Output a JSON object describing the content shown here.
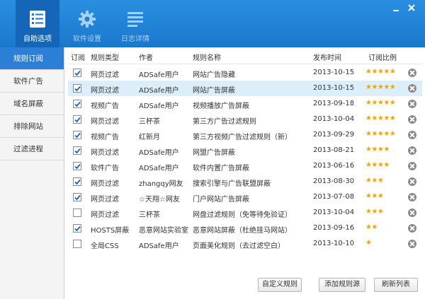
{
  "toolbar": {
    "items": [
      {
        "label": "自助选项",
        "icon": "checklist-icon"
      },
      {
        "label": "软件设置",
        "icon": "gear-icon"
      },
      {
        "label": "日志详情",
        "icon": "log-list-icon"
      }
    ]
  },
  "window": {
    "minimize_icon": "minimize-icon",
    "close_icon": "close-icon"
  },
  "colors": {
    "accent": "#1a78cc",
    "active_tab": "#1565b8",
    "sidebar_active": "#2c7fd6",
    "star": "#f0a500",
    "selected_row": "#ddeefb"
  },
  "sidebar": {
    "items": [
      {
        "label": "规则订阅"
      },
      {
        "label": "软件广告"
      },
      {
        "label": "域名屏蔽"
      },
      {
        "label": "排除网站"
      },
      {
        "label": "过滤进程"
      }
    ]
  },
  "table": {
    "headers": {
      "subscribe": "订阅",
      "type": "规则类型",
      "author": "作者",
      "name": "规则名称",
      "date": "发布时间",
      "ratio": "订阅比例"
    },
    "rows": [
      {
        "checked": true,
        "type": "网页过滤",
        "author": "ADSafe用户",
        "name": "网站广告隐藏",
        "date": "2013-10-15",
        "stars": "★★★★★",
        "rating": 5
      },
      {
        "checked": true,
        "type": "网页过滤",
        "author": "ADSafe用户",
        "name": "网站广告屏蔽",
        "date": "2013-10-15",
        "stars": "★★★★★",
        "rating": 5
      },
      {
        "checked": true,
        "type": "视频广告",
        "author": "ADSafe用户",
        "name": "视频播放广告屏蔽",
        "date": "2013-09-18",
        "stars": "★★★★★",
        "rating": 5
      },
      {
        "checked": true,
        "type": "网页过滤",
        "author": "三杯茶",
        "name": "第三方广告过滤规则",
        "date": "2013-10-04",
        "stars": "★★★★★",
        "rating": 5
      },
      {
        "checked": true,
        "type": "视频广告",
        "author": "红新月",
        "name": "第三方视频广告过滤规则（新）",
        "date": "2013-09-29",
        "stars": "★★★★★",
        "rating": 5
      },
      {
        "checked": true,
        "type": "网页过滤",
        "author": "ADSafe用户",
        "name": "网盟广告屏蔽",
        "date": "2013-08-21",
        "stars": "★★★★",
        "rating": 4
      },
      {
        "checked": true,
        "type": "软件广告",
        "author": "ADSafe用户",
        "name": "软件内置广告屏蔽",
        "date": "2013-06-16",
        "stars": "★★★★",
        "rating": 4
      },
      {
        "checked": true,
        "type": "网页过滤",
        "author": "zhangqy网友",
        "name": "搜索引擎与广告联盟屏蔽",
        "date": "2013-08-30",
        "stars": "★★★",
        "rating": 3
      },
      {
        "checked": true,
        "type": "网页过滤",
        "author": "☆天翔☆网友",
        "name": "门户网站广告屏蔽",
        "date": "2013-07-08",
        "stars": "★★★",
        "rating": 3
      },
      {
        "checked": false,
        "type": "网页过滤",
        "author": "三杯茶",
        "name": "网盘过滤规则（免等待免验证）",
        "date": "2013-10-04",
        "stars": "★★★",
        "rating": 3
      },
      {
        "checked": true,
        "type": "HOSTS屏蔽",
        "author": "恶意网站实验室",
        "name": "恶意网站屏蔽（杜绝挂马网站）",
        "date": "2013-09-16",
        "stars": "★★",
        "rating": 2
      },
      {
        "checked": false,
        "type": "全局CSS",
        "author": "ADSafe用户",
        "name": "页面美化规则（去过滤空白）",
        "date": "2013-10-10",
        "stars": "★",
        "rating": 1
      }
    ]
  },
  "buttons": {
    "custom": "自定义规则",
    "add_source": "添加规则源",
    "refresh": "刷新列表"
  }
}
